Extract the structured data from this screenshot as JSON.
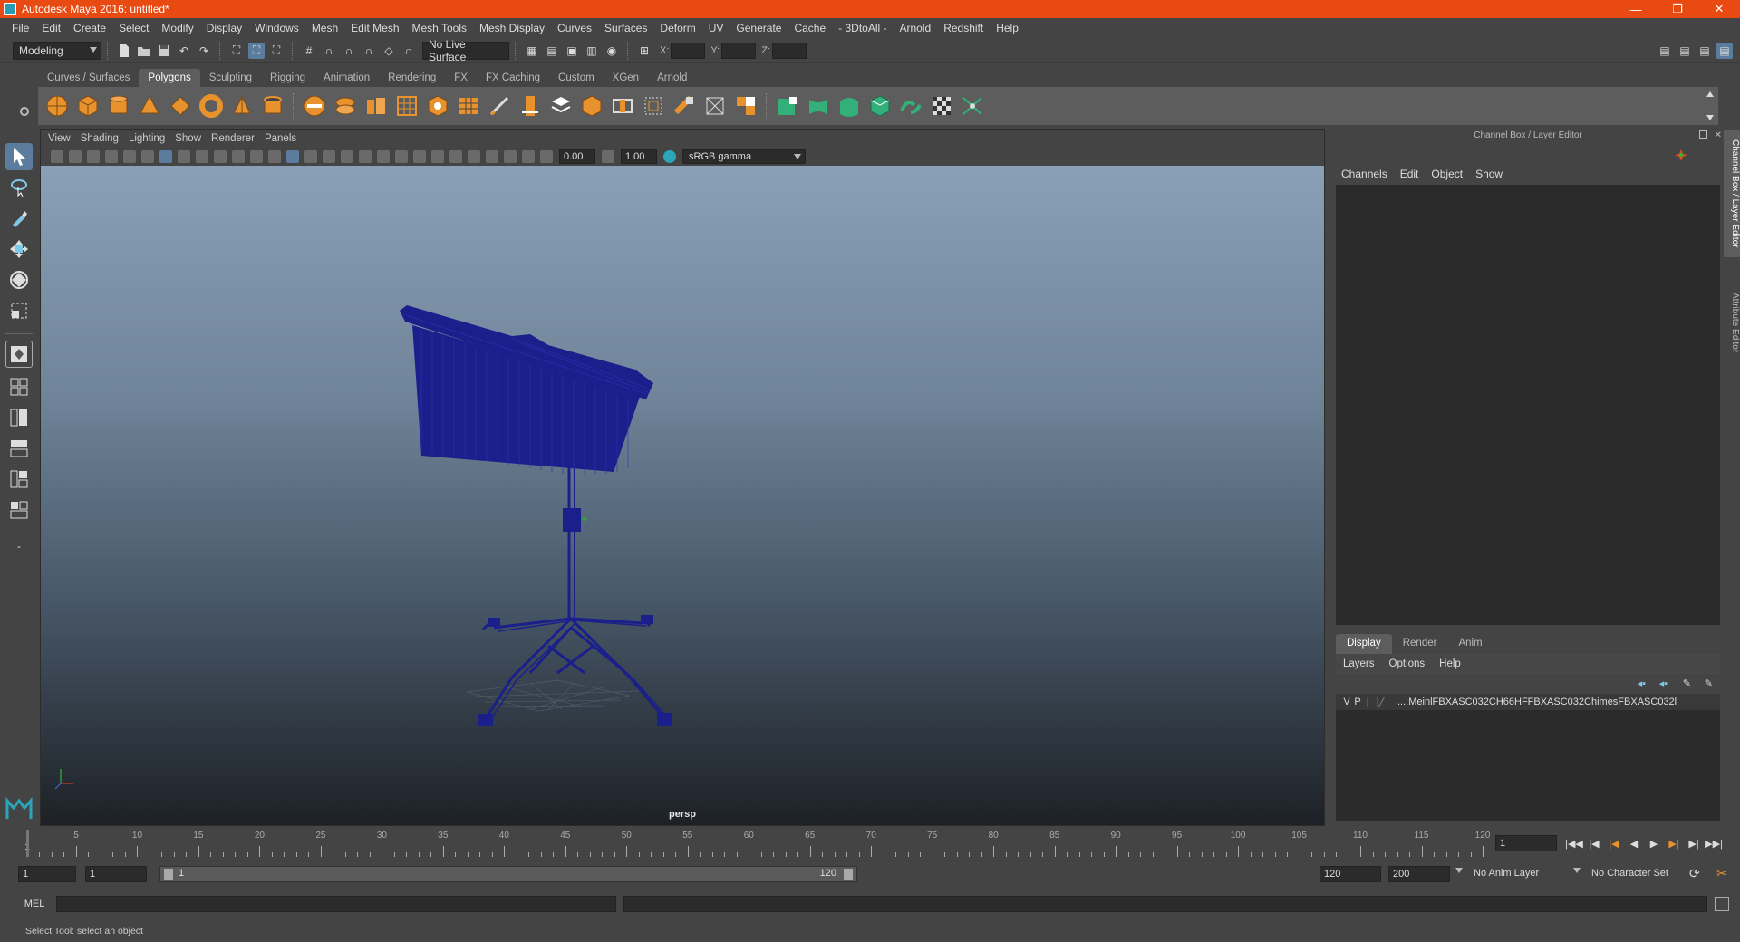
{
  "window": {
    "title": "Autodesk Maya 2016: untitled*",
    "minimize": "—",
    "maximize": "❐",
    "close": "✕"
  },
  "menubar": [
    "File",
    "Edit",
    "Create",
    "Select",
    "Modify",
    "Display",
    "Windows",
    "Mesh",
    "Edit Mesh",
    "Mesh Tools",
    "Mesh Display",
    "Curves",
    "Surfaces",
    "Deform",
    "UV",
    "Generate",
    "Cache",
    "- 3DtoAll -",
    "Arnold",
    "Redshift",
    "Help"
  ],
  "statusline": {
    "mode": "Modeling",
    "live_surface": "No Live Surface",
    "x_label": "X:",
    "y_label": "Y:",
    "z_label": "Z:"
  },
  "shelf": {
    "tabs": [
      "Curves / Surfaces",
      "Polygons",
      "Sculpting",
      "Rigging",
      "Animation",
      "Rendering",
      "FX",
      "FX Caching",
      "Custom",
      "XGen",
      "Arnold"
    ],
    "active_tab": "Polygons"
  },
  "viewport": {
    "menu": [
      "View",
      "Shading",
      "Lighting",
      "Show",
      "Renderer",
      "Panels"
    ],
    "exposure": "0.00",
    "gamma": "1.00",
    "color_space": "sRGB gamma",
    "camera": "persp"
  },
  "right_panel": {
    "title": "Channel Box / Layer Editor",
    "menu": [
      "Channels",
      "Edit",
      "Object",
      "Show"
    ],
    "layer_tabs": [
      "Display",
      "Render",
      "Anim"
    ],
    "active_layer_tab": "Display",
    "layer_menu": [
      "Layers",
      "Options",
      "Help"
    ],
    "layers": [
      {
        "v": "V",
        "p": "P",
        "name": "...:MeinlFBXASC032CH66HFFBXASC032ChimesFBXASC032l"
      }
    ],
    "side_tabs": [
      "Channel Box / Layer Editor",
      "Attribute Editor"
    ]
  },
  "timeline": {
    "tick_labels": [
      "1",
      "5",
      "10",
      "15",
      "20",
      "25",
      "30",
      "35",
      "40",
      "45",
      "50",
      "55",
      "60",
      "65",
      "70",
      "75",
      "80",
      "85",
      "90",
      "95",
      "100",
      "105",
      "110",
      "115",
      "120"
    ],
    "current_frame": "1"
  },
  "range": {
    "start": "1",
    "playback_start": "1",
    "slider_start": "1",
    "slider_end": "120",
    "playback_end": "120",
    "end": "200",
    "anim_layer": "No Anim Layer",
    "character_set": "No Character Set"
  },
  "command": {
    "label": "MEL"
  },
  "help": {
    "text": "Select Tool: select an object"
  },
  "colors": {
    "titlebar": "#e84a12",
    "panel": "#444444",
    "field": "#2b2b2b",
    "wire": "#1a1f8c",
    "shelf_orange": "#e8922e",
    "shelf_green": "#33b07a"
  }
}
